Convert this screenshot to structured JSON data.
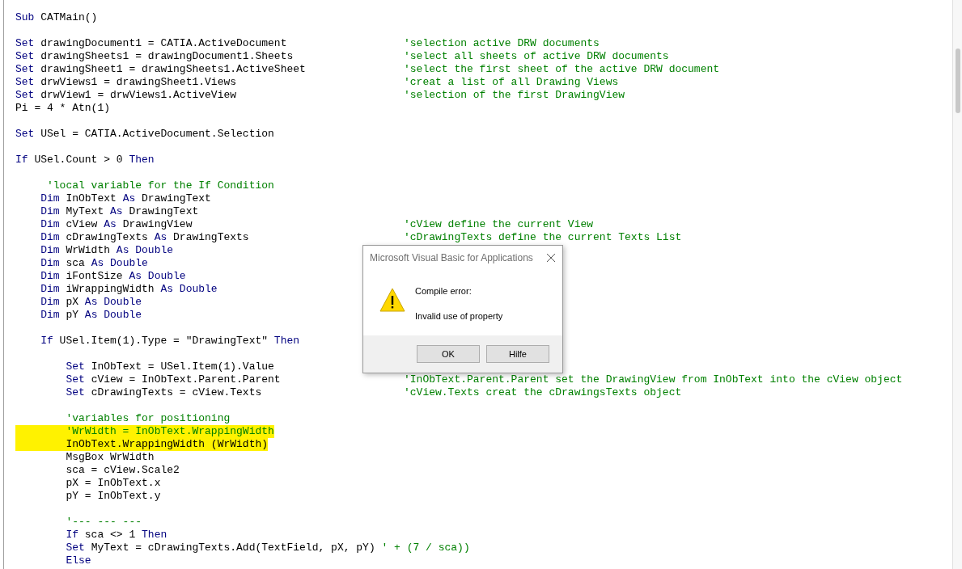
{
  "editor": {
    "lines": [
      {
        "highlighted": false,
        "tokens": [
          {
            "kind": "keyword",
            "text": "Sub"
          },
          {
            "kind": "plain",
            "text": " CATMain()"
          }
        ]
      },
      {
        "highlighted": false
      },
      {
        "highlighted": false,
        "tokens": [
          {
            "kind": "keyword",
            "text": "Set"
          },
          {
            "kind": "plain",
            "text": " drawingDocument1 = CATIA.ActiveDocument"
          }
        ],
        "comment": "'selection active DRW documents"
      },
      {
        "highlighted": false,
        "tokens": [
          {
            "kind": "keyword",
            "text": "Set"
          },
          {
            "kind": "plain",
            "text": " drawingSheets1 = drawingDocument1.Sheets"
          }
        ],
        "comment": "'select all sheets of active DRW documents"
      },
      {
        "highlighted": false,
        "tokens": [
          {
            "kind": "keyword",
            "text": "Set"
          },
          {
            "kind": "plain",
            "text": " drawingSheet1 = drawingSheets1.ActiveSheet"
          }
        ],
        "comment": "'select the first sheet of the active DRW document"
      },
      {
        "highlighted": false,
        "tokens": [
          {
            "kind": "keyword",
            "text": "Set"
          },
          {
            "kind": "plain",
            "text": " drwViews1 = drawingSheet1.Views"
          }
        ],
        "comment": "'creat a list of all Drawing Views"
      },
      {
        "highlighted": false,
        "tokens": [
          {
            "kind": "keyword",
            "text": "Set"
          },
          {
            "kind": "plain",
            "text": " drwView1 = drwViews1.ActiveView"
          }
        ],
        "comment": "'selection of the first DrawingView"
      },
      {
        "highlighted": false,
        "tokens": [
          {
            "kind": "plain",
            "text": "Pi = 4 * Atn(1)"
          }
        ]
      },
      {
        "highlighted": false
      },
      {
        "highlighted": false,
        "tokens": [
          {
            "kind": "keyword",
            "text": "Set"
          },
          {
            "kind": "plain",
            "text": " USel = CATIA.ActiveDocument.Selection"
          }
        ]
      },
      {
        "highlighted": false
      },
      {
        "highlighted": false,
        "tokens": [
          {
            "kind": "keyword",
            "text": "If"
          },
          {
            "kind": "plain",
            "text": " USel.Count > 0 "
          },
          {
            "kind": "keyword",
            "text": "Then"
          }
        ]
      },
      {
        "highlighted": false
      },
      {
        "highlighted": false,
        "tokens": [
          {
            "kind": "comment",
            "text": "     'local variable for the If Condition"
          }
        ]
      },
      {
        "highlighted": false,
        "tokens": [
          {
            "kind": "keyword",
            "text": "    Dim"
          },
          {
            "kind": "plain",
            "text": " InObText "
          },
          {
            "kind": "keyword",
            "text": "As"
          },
          {
            "kind": "plain",
            "text": " DrawingText"
          }
        ]
      },
      {
        "highlighted": false,
        "tokens": [
          {
            "kind": "keyword",
            "text": "    Dim"
          },
          {
            "kind": "plain",
            "text": " MyText "
          },
          {
            "kind": "keyword",
            "text": "As"
          },
          {
            "kind": "plain",
            "text": " DrawingText"
          }
        ]
      },
      {
        "highlighted": false,
        "tokens": [
          {
            "kind": "keyword",
            "text": "    Dim"
          },
          {
            "kind": "plain",
            "text": " cView "
          },
          {
            "kind": "keyword",
            "text": "As"
          },
          {
            "kind": "plain",
            "text": " DrawingView"
          }
        ],
        "comment": "'cView define the current View"
      },
      {
        "highlighted": false,
        "tokens": [
          {
            "kind": "keyword",
            "text": "    Dim"
          },
          {
            "kind": "plain",
            "text": " cDrawingTexts "
          },
          {
            "kind": "keyword",
            "text": "As"
          },
          {
            "kind": "plain",
            "text": " DrawingTexts"
          }
        ],
        "comment": "'cDrawingTexts define the current Texts List"
      },
      {
        "highlighted": false,
        "tokens": [
          {
            "kind": "keyword",
            "text": "    Dim"
          },
          {
            "kind": "plain",
            "text": " WrWidth "
          },
          {
            "kind": "keyword",
            "text": "As Double"
          }
        ]
      },
      {
        "highlighted": false,
        "tokens": [
          {
            "kind": "keyword",
            "text": "    Dim"
          },
          {
            "kind": "plain",
            "text": " sca "
          },
          {
            "kind": "keyword",
            "text": "As Double"
          }
        ]
      },
      {
        "highlighted": false,
        "tokens": [
          {
            "kind": "keyword",
            "text": "    Dim"
          },
          {
            "kind": "plain",
            "text": " iFontSize "
          },
          {
            "kind": "keyword",
            "text": "As Double"
          }
        ]
      },
      {
        "highlighted": false,
        "tokens": [
          {
            "kind": "keyword",
            "text": "    Dim"
          },
          {
            "kind": "plain",
            "text": " iWrappingWidth "
          },
          {
            "kind": "keyword",
            "text": "As Double"
          }
        ]
      },
      {
        "highlighted": false,
        "tokens": [
          {
            "kind": "keyword",
            "text": "    Dim"
          },
          {
            "kind": "plain",
            "text": " pX "
          },
          {
            "kind": "keyword",
            "text": "As Double"
          }
        ]
      },
      {
        "highlighted": false,
        "tokens": [
          {
            "kind": "keyword",
            "text": "    Dim"
          },
          {
            "kind": "plain",
            "text": " pY "
          },
          {
            "kind": "keyword",
            "text": "As Double"
          }
        ]
      },
      {
        "highlighted": false
      },
      {
        "highlighted": false,
        "tokens": [
          {
            "kind": "keyword",
            "text": "    If"
          },
          {
            "kind": "plain",
            "text": " USel.Item(1).Type = \"DrawingText\" "
          },
          {
            "kind": "keyword",
            "text": "Then"
          }
        ]
      },
      {
        "highlighted": false
      },
      {
        "highlighted": false,
        "tokens": [
          {
            "kind": "keyword",
            "text": "        Set"
          },
          {
            "kind": "plain",
            "text": " InObText = USel.Item(1).Value"
          }
        ]
      },
      {
        "highlighted": false,
        "tokens": [
          {
            "kind": "keyword",
            "text": "        Set"
          },
          {
            "kind": "plain",
            "text": " cView = InObText.Parent.Parent"
          }
        ],
        "comment": "'InObText.Parent.Parent set the DrawingView from InObText into the cView object"
      },
      {
        "highlighted": false,
        "tokens": [
          {
            "kind": "keyword",
            "text": "        Set"
          },
          {
            "kind": "plain",
            "text": " cDrawingTexts = cView.Texts"
          }
        ],
        "comment": "'cView.Texts creat the cDrawingsTexts object"
      },
      {
        "highlighted": false
      },
      {
        "highlighted": false,
        "tokens": [
          {
            "kind": "comment",
            "text": "        'variables for positioning"
          }
        ]
      },
      {
        "highlighted": true,
        "tokens": [
          {
            "kind": "comment",
            "text": "        'WrWidth = InObText.WrappingWidth"
          }
        ]
      },
      {
        "highlighted": true,
        "tokens": [
          {
            "kind": "plain",
            "text": "        InObText.WrappingWidth (WrWidth)"
          }
        ]
      },
      {
        "highlighted": false,
        "tokens": [
          {
            "kind": "plain",
            "text": "        MsgBox WrWidth"
          }
        ]
      },
      {
        "highlighted": false,
        "tokens": [
          {
            "kind": "plain",
            "text": "        sca = cView.Scale2"
          }
        ]
      },
      {
        "highlighted": false,
        "tokens": [
          {
            "kind": "plain",
            "text": "        pX = InObText.x"
          }
        ]
      },
      {
        "highlighted": false,
        "tokens": [
          {
            "kind": "plain",
            "text": "        pY = InObText.y"
          }
        ]
      },
      {
        "highlighted": false
      },
      {
        "highlighted": false,
        "tokens": [
          {
            "kind": "comment",
            "text": "        '--- --- ---"
          }
        ]
      },
      {
        "highlighted": false,
        "tokens": [
          {
            "kind": "keyword",
            "text": "        If"
          },
          {
            "kind": "plain",
            "text": " sca <> 1 "
          },
          {
            "kind": "keyword",
            "text": "Then"
          }
        ]
      },
      {
        "highlighted": false,
        "tokens": [
          {
            "kind": "keyword",
            "text": "        Set"
          },
          {
            "kind": "plain",
            "text": " MyText = cDrawingTexts.Add(TextField, pX, pY) "
          },
          {
            "kind": "comment",
            "text": "' + (7 / sca))"
          }
        ]
      },
      {
        "highlighted": false,
        "tokens": [
          {
            "kind": "keyword",
            "text": "        Else"
          }
        ]
      }
    ]
  },
  "dialog": {
    "title": "Microsoft Visual Basic for Applications",
    "heading": "Compile error:",
    "message": "Invalid use of property",
    "buttons": [
      "OK",
      "Hilfe"
    ]
  }
}
